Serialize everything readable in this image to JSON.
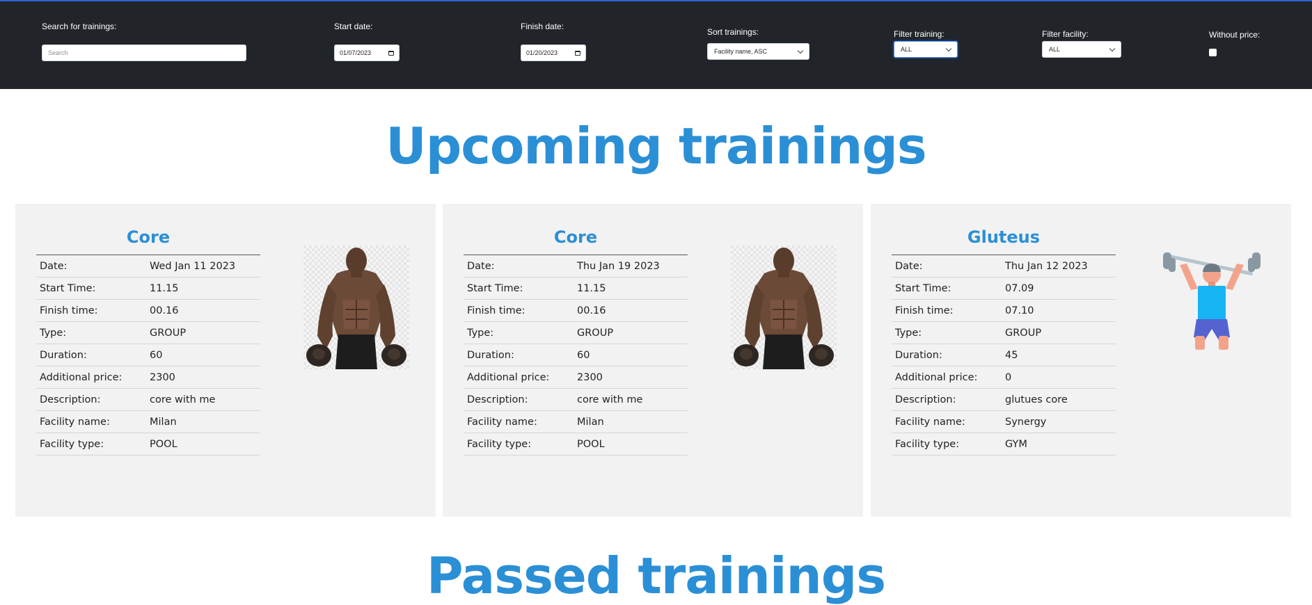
{
  "filters": {
    "search_label": "Search for trainings:",
    "search_placeholder": "Search",
    "start_date_label": "Start date:",
    "start_date_value": "01/07/2023",
    "finish_date_label": "Finish date:",
    "finish_date_value": "01/20/2023",
    "sort_label": "Sort trainings:",
    "sort_value": "Facility name, ASC",
    "filter_training_label": "Filter training:",
    "filter_training_value": "ALL",
    "filter_facility_label": "Filter facility:",
    "filter_facility_value": "ALL",
    "without_price_label": "Without price:",
    "without_price_checked": false
  },
  "page_title": "Upcoming trainings",
  "next_section_title": "Passed trainings",
  "field_labels": {
    "date": "Date:",
    "start_time": "Start Time:",
    "finish_time": "Finish time:",
    "type": "Type:",
    "duration": "Duration:",
    "additional_price": "Additional price:",
    "description": "Description:",
    "facility_name": "Facility name:",
    "facility_type": "Facility type:"
  },
  "trainings": [
    {
      "name": "Core",
      "date": "Wed Jan 11 2023",
      "start_time": "11.15",
      "finish_time": "00.16",
      "type": "GROUP",
      "duration": "60",
      "additional_price": "2300",
      "description": "core with me",
      "facility_name": "Milan",
      "facility_type": "POOL",
      "image": "bodybuilder-dumbbells"
    },
    {
      "name": "Core",
      "date": "Thu Jan 19 2023",
      "start_time": "11.15",
      "finish_time": "00.16",
      "type": "GROUP",
      "duration": "60",
      "additional_price": "2300",
      "description": "core with me",
      "facility_name": "Milan",
      "facility_type": "POOL",
      "image": "bodybuilder-dumbbells"
    },
    {
      "name": "Gluteus",
      "date": "Thu Jan 12 2023",
      "start_time": "07.09",
      "finish_time": "07.10",
      "type": "GROUP",
      "duration": "45",
      "additional_price": "0",
      "description": "glutues core",
      "facility_name": "Synergy",
      "facility_type": "GYM",
      "image": "weightlifter-illustration"
    }
  ],
  "colors": {
    "accent": "#2b8fd6",
    "topbar": "#212529",
    "card_bg": "#f2f2f2",
    "focus": "#5b8ff9"
  }
}
